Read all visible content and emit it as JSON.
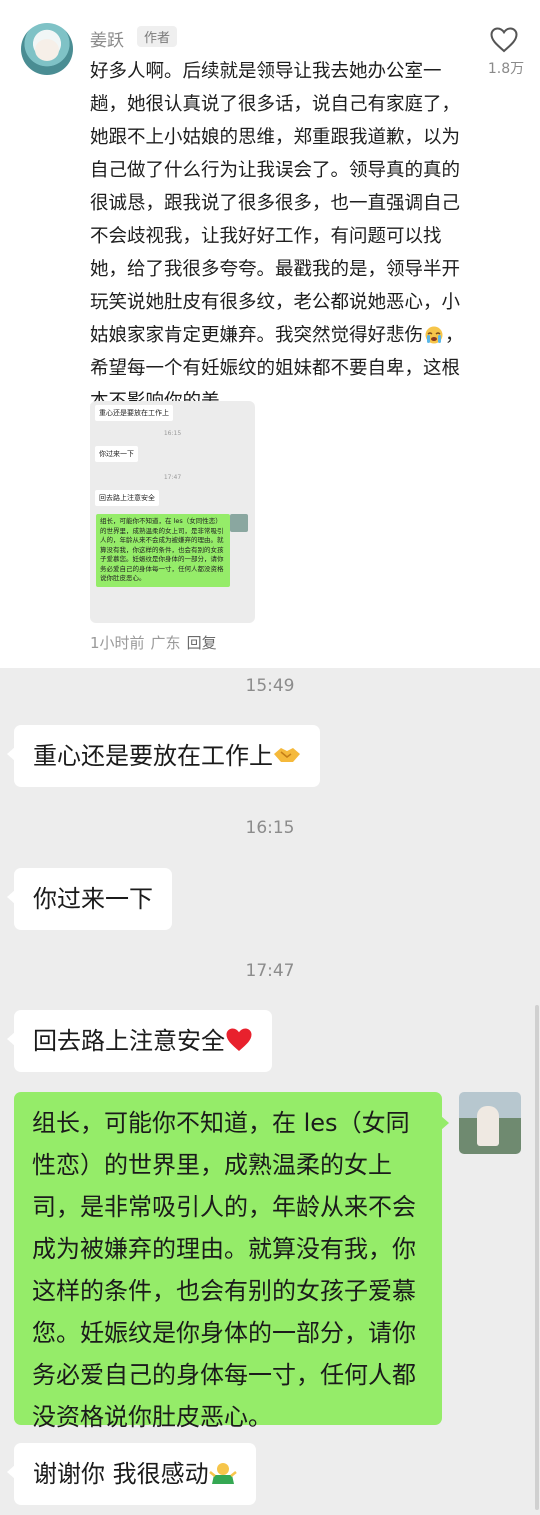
{
  "comment": {
    "author_name": "姜跃",
    "author_badge": "作者",
    "like_count": "1.8万",
    "text_part1": "好多人啊。后续就是领导让我去她办公室一趟，她很认真说了很多话，说自己有家庭了，她跟不上小姑娘的思维，郑重跟我道歉，以为自己做了什么行为让我误会了。领导真的真的很诚恳，跟我说了很多很多，也一直强调自己不会歧视我，让我好好工作，有问题可以找她，给了我很多夸夸。最戳我的是，领导半开玩笑说她肚皮有很多纹，老公都说她恶心，小姑娘家家肯定更嫌弃。我突然觉得好悲伤",
    "text_part2": "，希望每一个有妊娠纹的姐妹都不要自卑，这根本不影响你的美",
    "emoji": "crying-face-emoji",
    "meta_time": "1小时前",
    "meta_location": "广东",
    "meta_reply": "回复"
  },
  "thumbnail": {
    "msg1": "重心还是要放在工作上",
    "time1": "16:15",
    "msg2": "你过来一下",
    "time2": "17:47",
    "msg3": "回去路上注意安全",
    "msg4": "组长，可能你不知道，在 les（女同性恋）的世界里，成熟温柔的女上司，是非常吸引人的，年龄从来不会成为被嫌弃的理由。就算没有我，你这样的条件，也会有别的女孩子爱慕您。妊娠纹是你身体的一部分，请你务必爱自己的身体每一寸，任何人都没资格说你肚皮恶心。"
  },
  "chat": {
    "time1": "15:49",
    "msg1": "重心还是要放在工作上",
    "msg1_emoji": "handshake-emoji",
    "time2": "16:15",
    "msg2": "你过来一下",
    "time3": "17:47",
    "msg3": "回去路上注意安全",
    "msg3_emoji": "red-heart-emoji",
    "msg4": "组长，可能你不知道，在 les（女同性恋）的世界里，成熟温柔的女上司，是非常吸引人的，年龄从来不会成为被嫌弃的理由。就算没有我，你这样的条件，也会有别的女孩子爱慕您。妊娠纹是你身体的一部分，请你务必爱自己的身体每一寸，任何人都没资格说你肚皮恶心。",
    "msg5": "谢谢你 我很感动",
    "msg5_emoji": "person-shrugging-emoji"
  },
  "colors": {
    "chat_background": "#ededed",
    "bubble_white": "#ffffff",
    "bubble_green": "#95ec69"
  }
}
